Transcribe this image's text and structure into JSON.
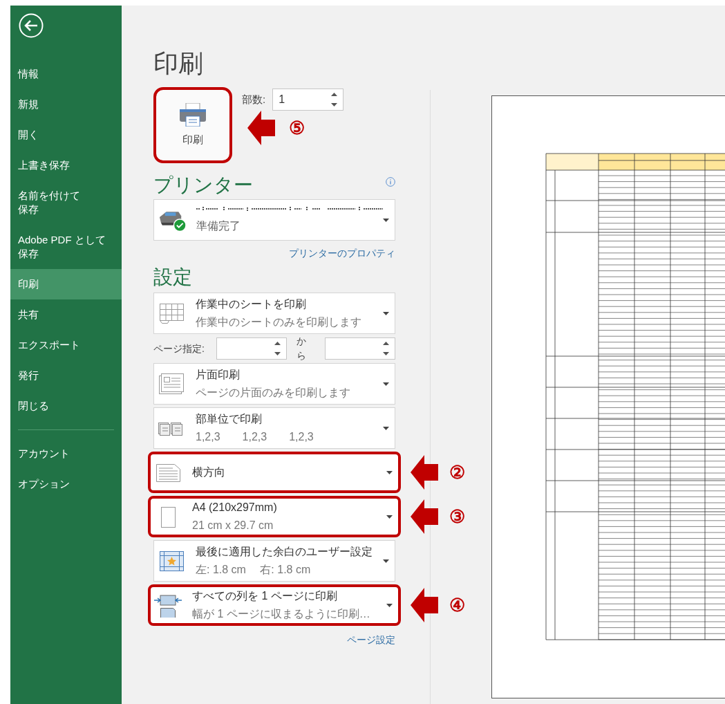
{
  "sidebar": {
    "items": [
      {
        "label": "情報",
        "selected": false
      },
      {
        "label": "新規",
        "selected": false
      },
      {
        "label": "開く",
        "selected": false
      },
      {
        "label": "上書き保存",
        "selected": false
      },
      {
        "label": "名前を付けて",
        "label_2": "保存",
        "selected": false
      },
      {
        "label": "Adobe PDF として",
        "label_2": "保存",
        "selected": false
      },
      {
        "label": "印刷",
        "selected": true
      },
      {
        "label": "共有",
        "selected": false
      },
      {
        "label": "エクスポート",
        "selected": false
      },
      {
        "label": "発行",
        "selected": false
      },
      {
        "label": "閉じる",
        "selected": false
      }
    ],
    "bottom_items": [
      {
        "label": "アカウント",
        "selected": false
      },
      {
        "label": "オプション",
        "selected": false
      }
    ]
  },
  "title": "印刷",
  "print_button": {
    "label": "印刷",
    "callout": "⑤"
  },
  "copies": {
    "label": "部数:",
    "value": "1"
  },
  "printer": {
    "heading": "プリンター",
    "status": "準備完了",
    "properties_link": "プリンターのプロパティ"
  },
  "settings": {
    "heading": "設定",
    "options": [
      {
        "kind": "sheet",
        "title": "作業中のシートを印刷",
        "subtitle": "作業中のシートのみを印刷します"
      },
      {
        "kind": "duplex",
        "title": "片面印刷",
        "subtitle": "ページの片面のみを印刷します"
      },
      {
        "kind": "collate",
        "title": "部単位で印刷",
        "subtitle": "1,2,3　　1,2,3　　1,2,3"
      },
      {
        "kind": "orientation",
        "title": "横方向",
        "callout": "②"
      },
      {
        "kind": "paper",
        "title": "A4 (210x297mm)",
        "subtitle": "21 cm x 29.7 cm",
        "callout": "③"
      },
      {
        "kind": "margins",
        "title": "最後に適用した余白のユーザー設定",
        "subtitle": "左:  1.8 cm　 右:  1.8 cm"
      },
      {
        "kind": "scaling",
        "title": "すべての列を 1 ページに印刷",
        "subtitle": "幅が 1 ページに収まるように印刷…",
        "callout": "④"
      }
    ],
    "page_range": {
      "label": "ページ指定:",
      "to_label": "から"
    },
    "page_setup_link": "ページ設定"
  }
}
